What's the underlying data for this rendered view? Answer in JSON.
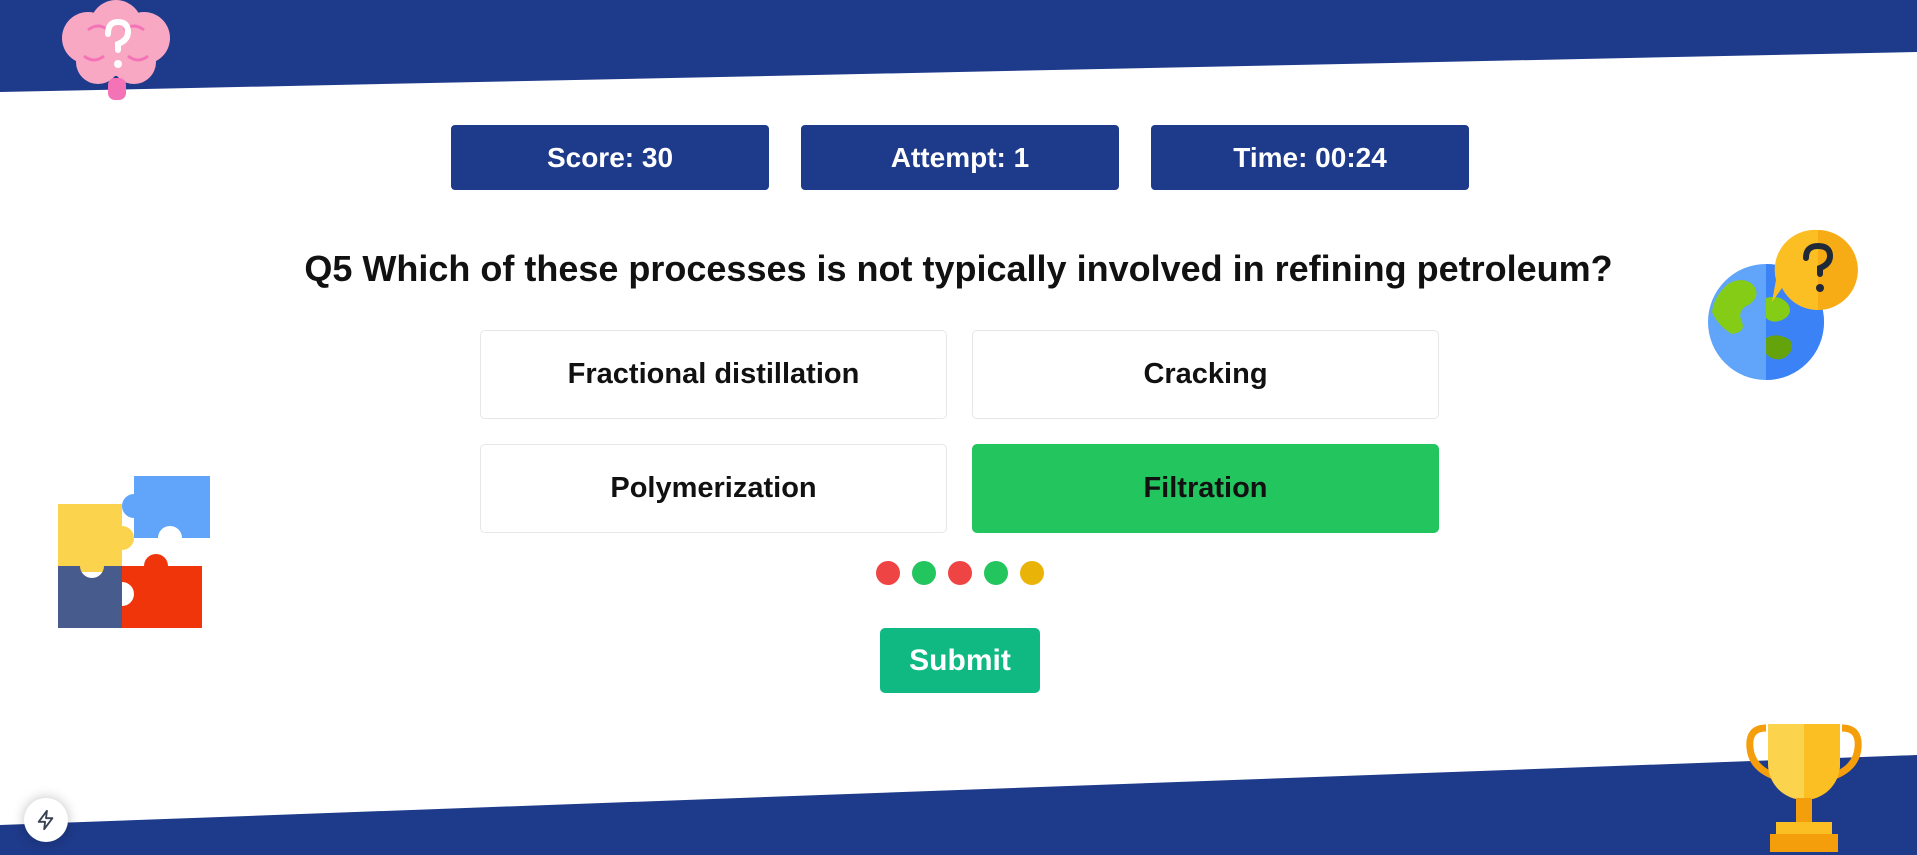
{
  "stats": {
    "score": "Score: 30",
    "attempt": "Attempt: 1",
    "time": "Time: 00:24"
  },
  "question": "Q5 Which of these processes is not typically involved in refining petroleum?",
  "options": [
    {
      "label": "Fractional distillation",
      "selected": false
    },
    {
      "label": "Cracking",
      "selected": false
    },
    {
      "label": "Polymerization",
      "selected": false
    },
    {
      "label": "Filtration",
      "selected": true
    }
  ],
  "progress_dots": [
    "#ef4444",
    "#22c55e",
    "#ef4444",
    "#22c55e",
    "#eab308"
  ],
  "submit_label": "Submit",
  "colors": {
    "brand": "#1e3a8a",
    "selected": "#22c55e",
    "submit": "#10b981"
  },
  "icons": {
    "brain": "brain-question-icon",
    "globe": "globe-question-icon",
    "puzzle": "puzzle-icon",
    "trophy": "trophy-icon",
    "bolt": "bolt-icon"
  }
}
